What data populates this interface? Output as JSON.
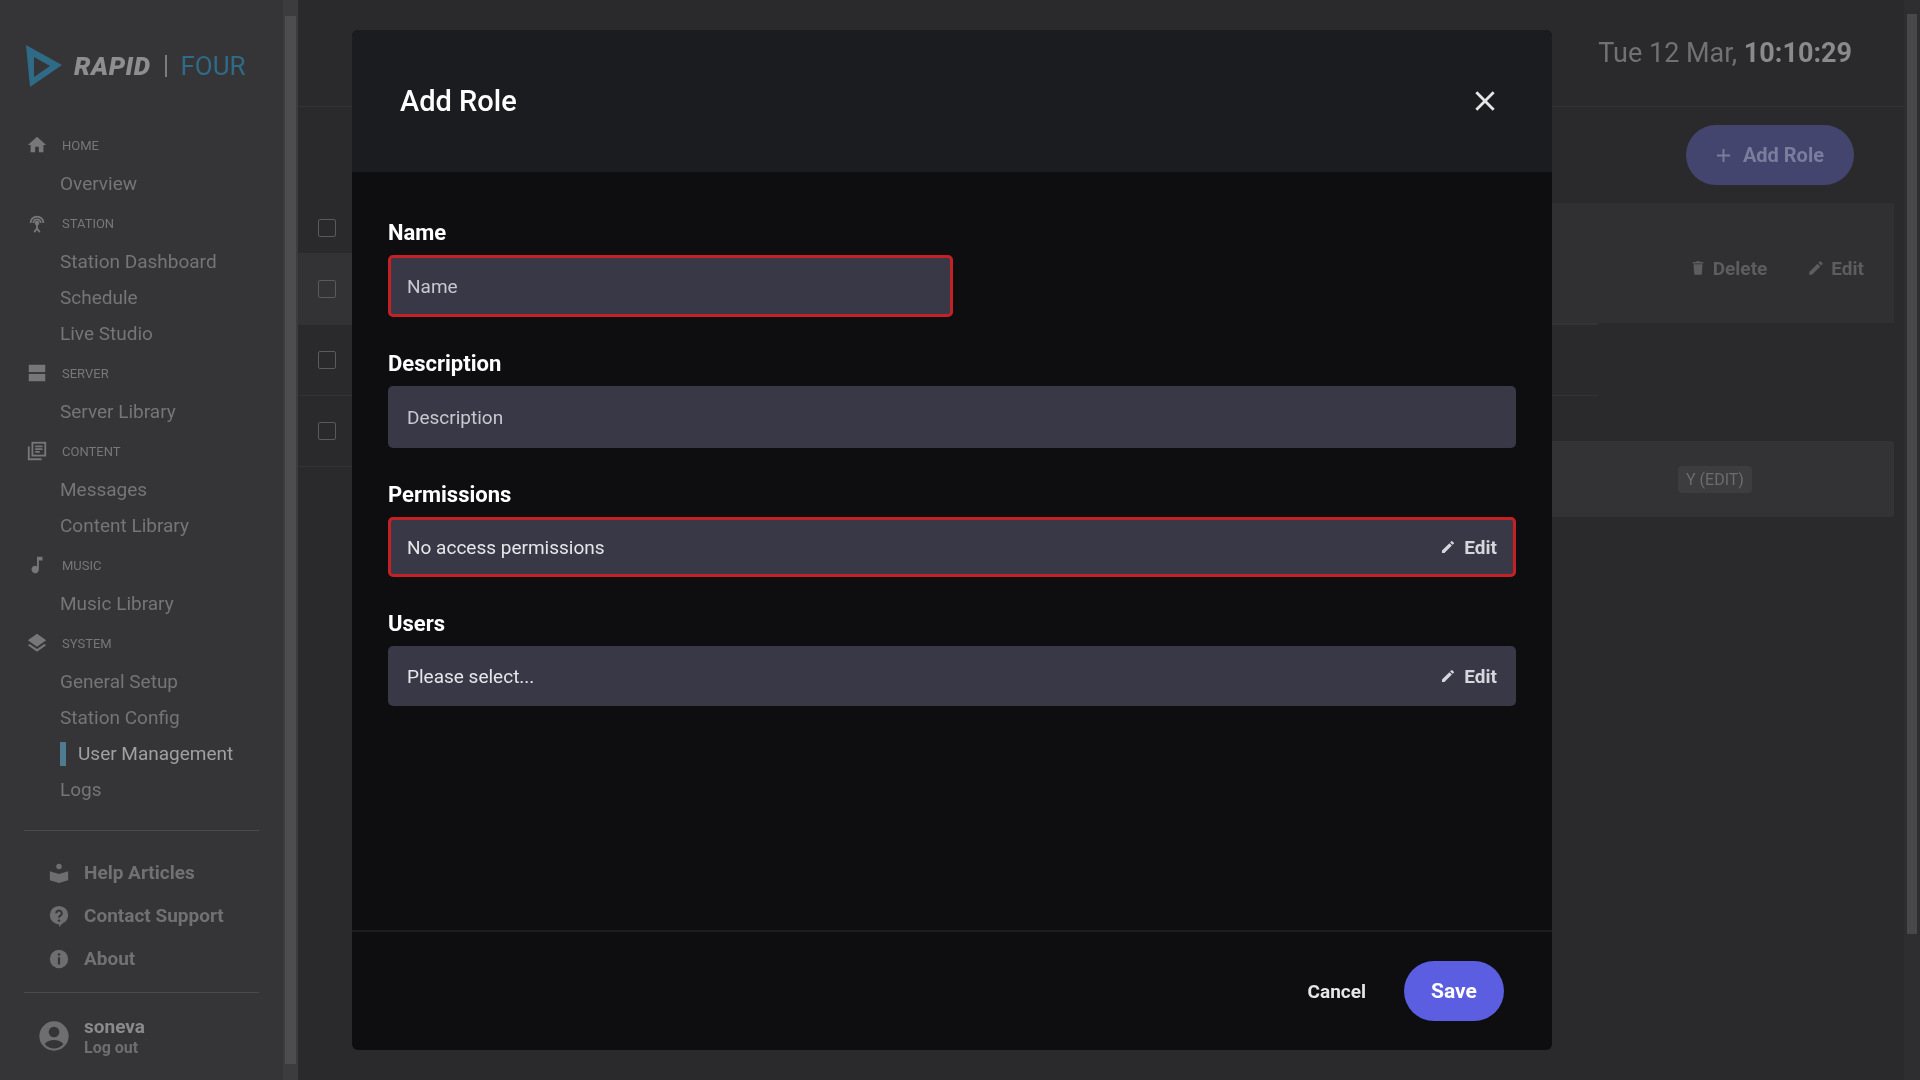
{
  "logo": {
    "brand": "RAPID",
    "product": "FOUR"
  },
  "sidebar": {
    "groups": [
      {
        "label": "HOME",
        "items": [
          {
            "label": "Overview",
            "selected": false
          }
        ]
      },
      {
        "label": "STATION",
        "items": [
          {
            "label": "Station Dashboard",
            "selected": false
          },
          {
            "label": "Schedule",
            "selected": false
          },
          {
            "label": "Live Studio",
            "selected": false
          }
        ]
      },
      {
        "label": "SERVER",
        "items": [
          {
            "label": "Server Library",
            "selected": false
          }
        ]
      },
      {
        "label": "CONTENT",
        "items": [
          {
            "label": "Messages",
            "selected": false
          },
          {
            "label": "Content Library",
            "selected": false
          }
        ]
      },
      {
        "label": "MUSIC",
        "items": [
          {
            "label": "Music Library",
            "selected": false
          }
        ]
      },
      {
        "label": "SYSTEM",
        "items": [
          {
            "label": "General Setup",
            "selected": false
          },
          {
            "label": "Station Config",
            "selected": false
          },
          {
            "label": "User Management",
            "selected": true
          },
          {
            "label": "Logs",
            "selected": false
          }
        ]
      }
    ],
    "links": [
      {
        "label": "Help Articles"
      },
      {
        "label": "Contact Support"
      },
      {
        "label": "About"
      }
    ],
    "user": {
      "name": "soneva",
      "action": "Log out"
    }
  },
  "header": {
    "date": "Tue 12 Mar,",
    "time": "10:10:29"
  },
  "toolbar": {
    "add_button": "Add Role"
  },
  "table": {
    "header_checked": false,
    "rows": [
      {
        "checked": false
      },
      {
        "checked": false
      },
      {
        "checked": false
      }
    ],
    "actions": [
      "Delete",
      "Edit"
    ],
    "tag": "Y (EDIT)"
  },
  "modal": {
    "title": "Add Role",
    "fields": [
      {
        "label": "Name",
        "kind": "short-text",
        "placeholder": "Name",
        "invalid": true
      },
      {
        "label": "Description",
        "kind": "text",
        "placeholder": "Description",
        "invalid": false
      },
      {
        "label": "Permissions",
        "kind": "picker",
        "value": "No access permissions",
        "action": "Edit",
        "invalid": true
      },
      {
        "label": "Users",
        "kind": "picker",
        "value": "Please select...",
        "action": "Edit",
        "invalid": false
      }
    ],
    "cancel": "Cancel",
    "save": "Save"
  }
}
